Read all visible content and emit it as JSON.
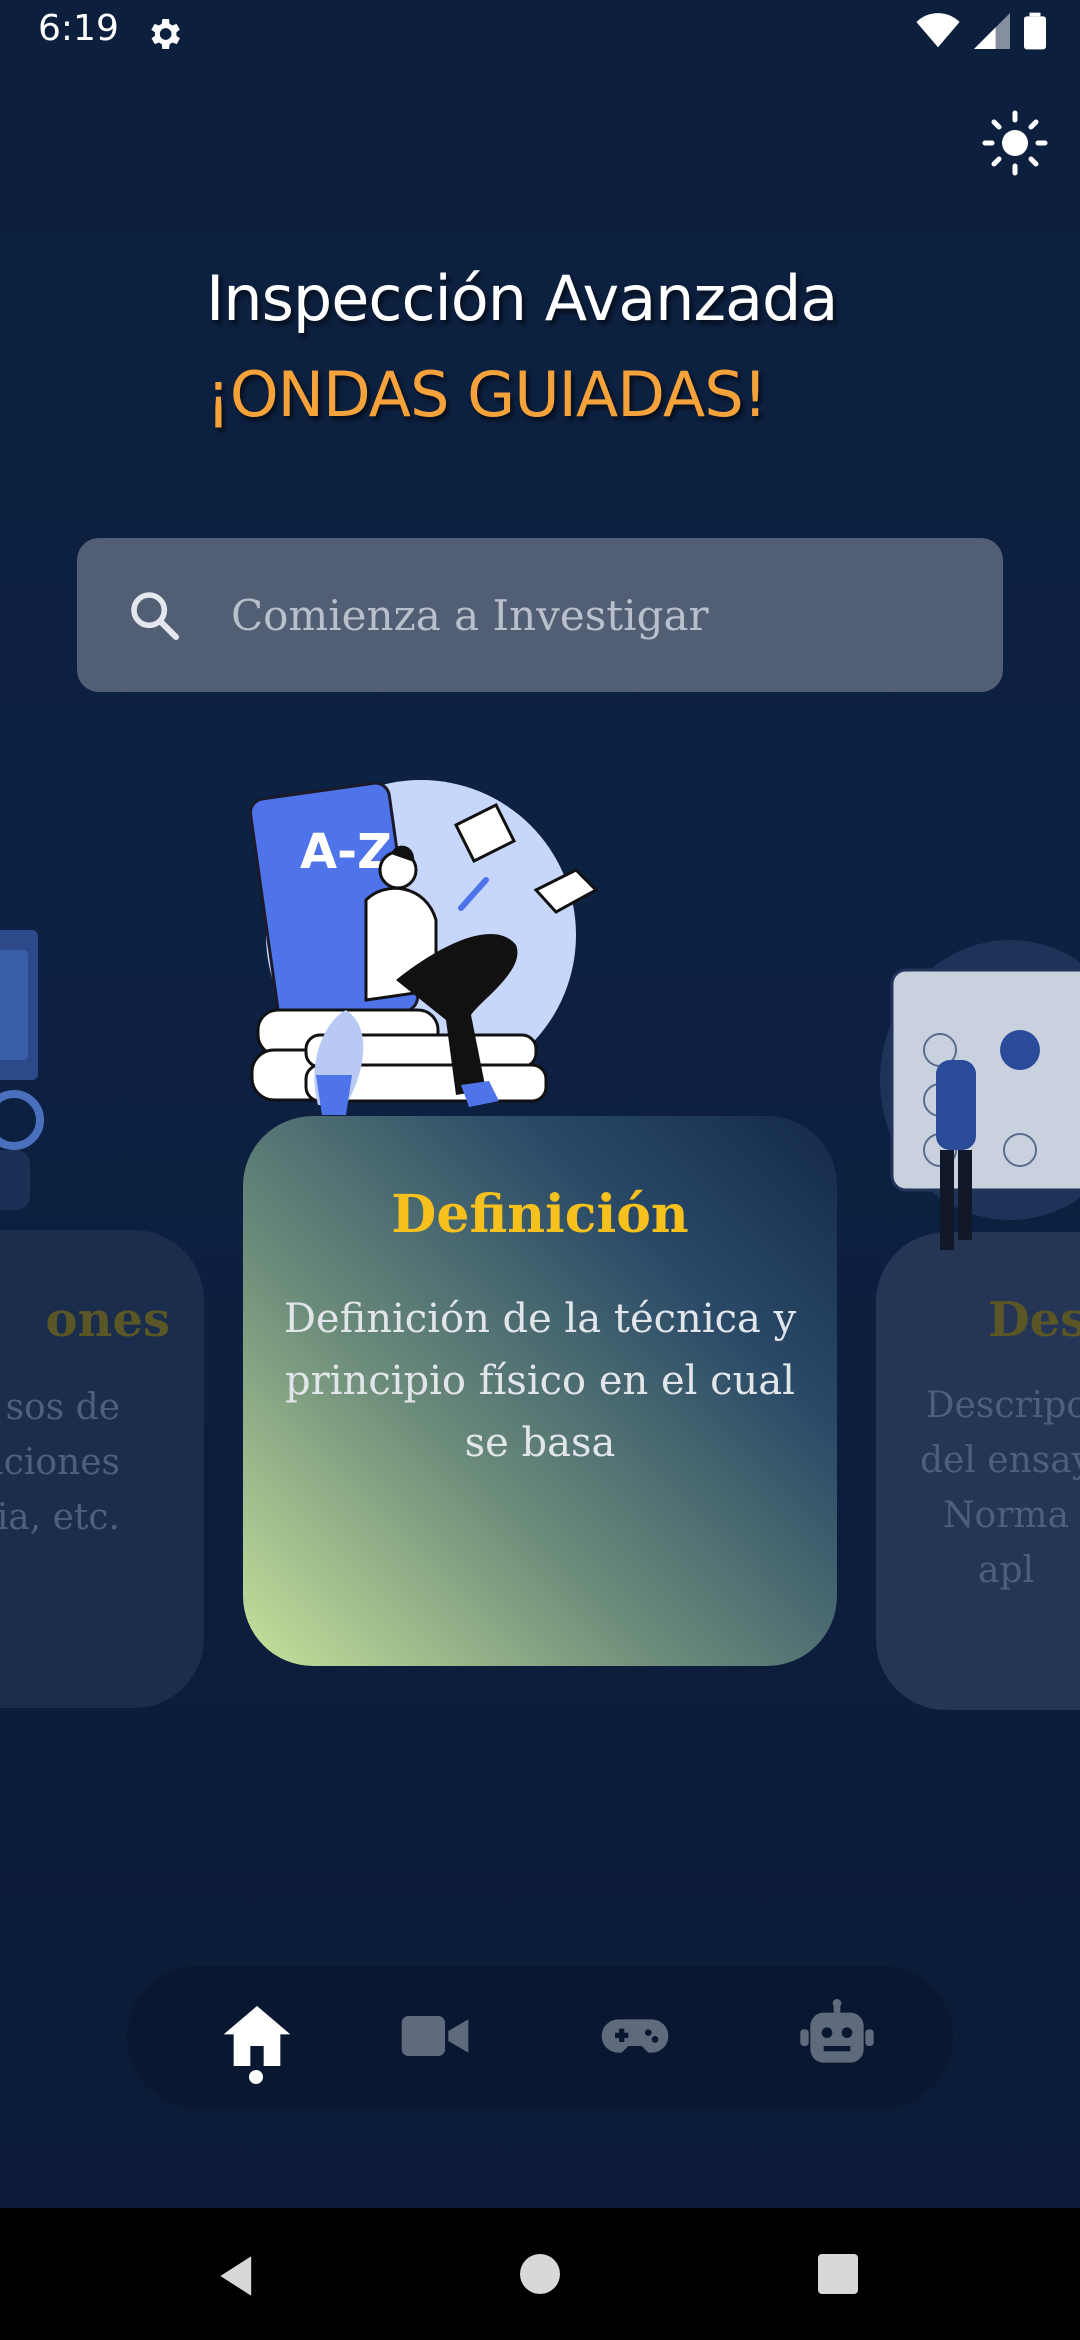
{
  "status_bar": {
    "time": "6:19"
  },
  "header": {
    "title": "Inspección Avanzada",
    "subtitle": "¡ONDAS GUIADAS!"
  },
  "search": {
    "placeholder": "Comienza a Investigar",
    "value": ""
  },
  "cards": {
    "left": {
      "title_fragment": "ones",
      "text_fragment": "sos de\naciones\nia, etc."
    },
    "main": {
      "title": "Definición",
      "text": "Definición de la técnica y principio físico en el cual se basa",
      "illustration_label": "A-Z"
    },
    "right": {
      "title_fragment": "Desc",
      "text_fragment": "Descripc\ndel ensay\nNorma\napl"
    }
  },
  "bottom_nav": {
    "items": [
      {
        "icon": "home-icon",
        "active": true
      },
      {
        "icon": "video-icon",
        "active": false
      },
      {
        "icon": "gamepad-icon",
        "active": false
      },
      {
        "icon": "robot-icon",
        "active": false
      }
    ]
  },
  "colors": {
    "background": "#0d2143",
    "accent_orange": "#f6a23a",
    "card_title_yellow": "#f7c11d",
    "search_bg": "#525e74",
    "nav_bg": "#0a1730"
  }
}
